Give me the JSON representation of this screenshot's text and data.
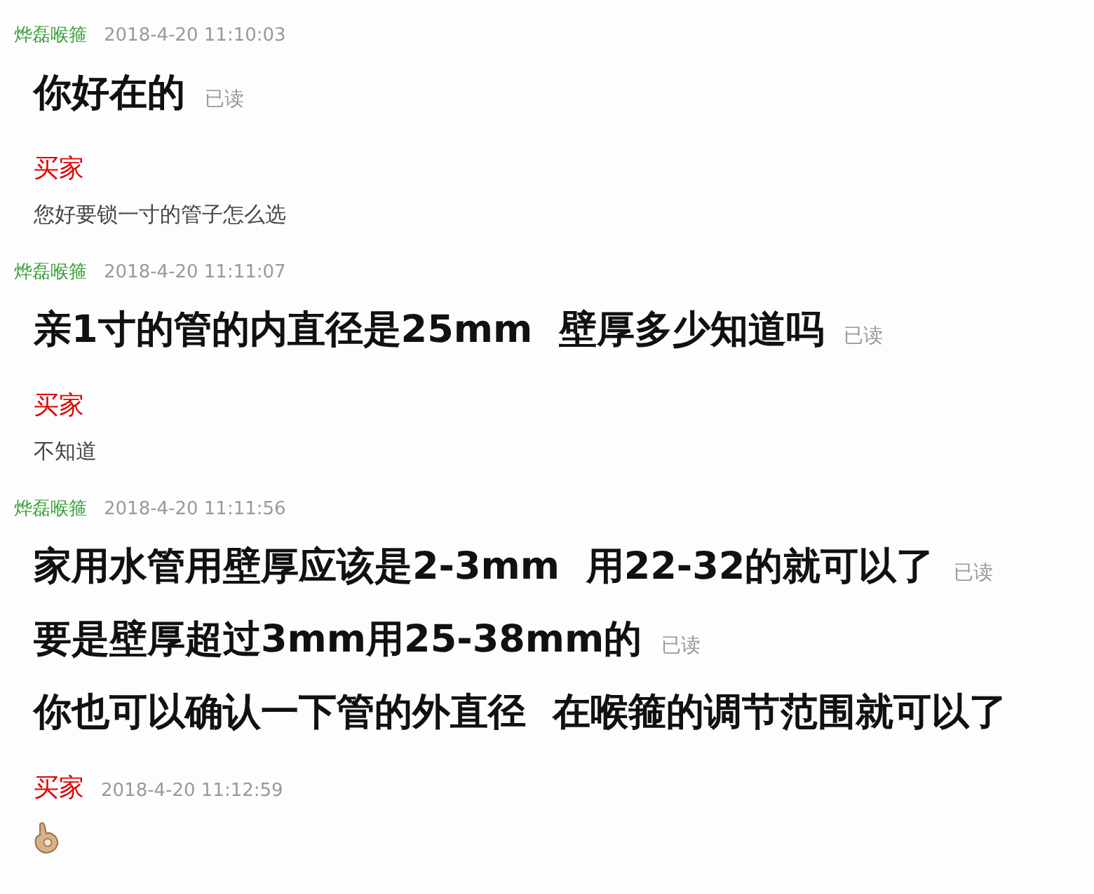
{
  "messages": [
    {
      "sender": "烨磊喉箍",
      "kind": "seller",
      "time": "2018-4-20 11:10:03",
      "lines": [
        {
          "kind": "text",
          "text": "你好在的",
          "read": "已读"
        }
      ]
    },
    {
      "sender": "买家",
      "kind": "buyer",
      "lines": [
        {
          "kind": "text",
          "text": "您好要锁一寸的管子怎么选"
        }
      ]
    },
    {
      "sender": "烨磊喉箍",
      "kind": "seller",
      "time": "2018-4-20 11:11:07",
      "lines": [
        {
          "kind": "text",
          "text": "亲1寸的管的内直径是25mm  壁厚多少知道吗",
          "read": "已读"
        }
      ]
    },
    {
      "sender": "买家",
      "kind": "buyer",
      "lines": [
        {
          "kind": "text",
          "text": "不知道"
        }
      ]
    },
    {
      "sender": "烨磊喉箍",
      "kind": "seller",
      "time": "2018-4-20 11:11:56",
      "lines": [
        {
          "kind": "text",
          "text": "家用水管用壁厚应该是2-3mm  用22-32的就可以了",
          "read": "已读"
        },
        {
          "kind": "text",
          "text": "要是壁厚超过3mm用25-38mm的",
          "read": "已读"
        },
        {
          "kind": "text",
          "text": "你也可以确认一下管的外直径  在喉箍的调节范围就可以了"
        }
      ]
    },
    {
      "sender": "买家",
      "kind": "buyer",
      "time": "2018-4-20 11:12:59",
      "lines": [
        {
          "kind": "emoji"
        }
      ]
    }
  ]
}
